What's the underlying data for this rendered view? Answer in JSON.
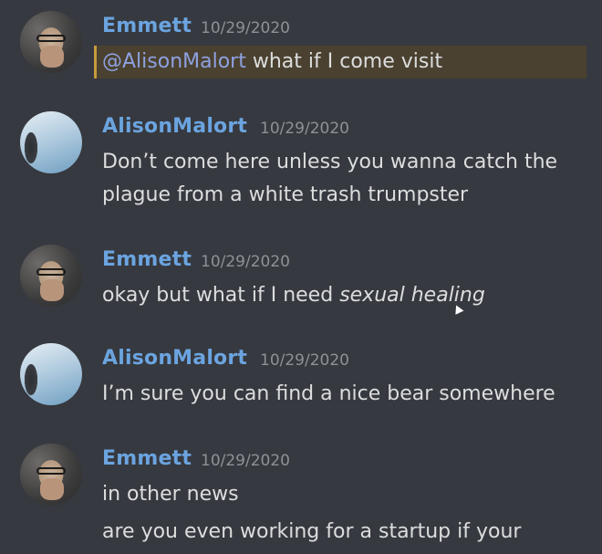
{
  "messages": [
    {
      "author": "Emmett",
      "time": "10/29/2020",
      "mention": "@AlisonMalort",
      "text": " what if I come visit"
    },
    {
      "author": "AlisonMalort",
      "time": "10/29/2020",
      "lines": [
        "Don’t come here unless you wanna catch the",
        "plague from a white trash trumpster"
      ]
    },
    {
      "author": "Emmett",
      "time": "10/29/2020",
      "text": "okay but what if I need ",
      "emphasis": "sexual healing"
    },
    {
      "author": "AlisonMalort",
      "time": "10/29/2020",
      "text": "I’m sure you can find a nice bear somewhere"
    },
    {
      "author": "Emmett",
      "time": "10/29/2020",
      "lines": [
        "in other news",
        "are you even working for a startup if your"
      ]
    }
  ],
  "icons": {
    "avatar_emmett": "avatar-emmett",
    "avatar_alison": "avatar-alison"
  },
  "colors": {
    "background": "#36393f",
    "username": "#6ba4e0",
    "timestamp": "#8e9297",
    "mention_highlight": "#4a4130",
    "mention_border": "#c79a3c",
    "mention_text": "#8ea1e1"
  }
}
